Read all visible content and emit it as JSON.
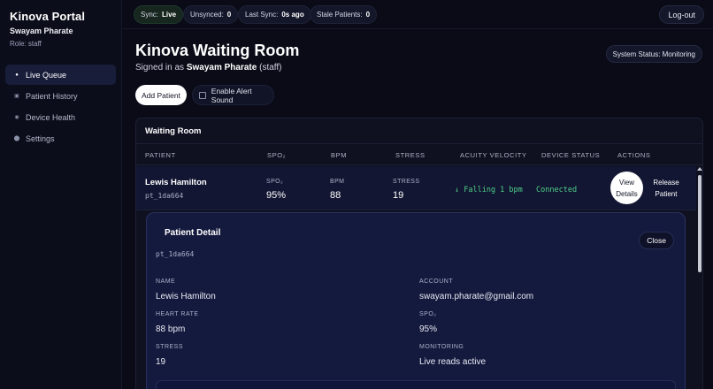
{
  "sidebar": {
    "brand": "Kinova Portal",
    "user_name": "Swayam Pharate",
    "user_role": "Role: staff",
    "items": [
      {
        "label": "Live Queue",
        "icon": "dot-icon"
      },
      {
        "label": "Patient History",
        "icon": "list-icon"
      },
      {
        "label": "Device Health",
        "icon": "gauge-icon"
      },
      {
        "label": "Settings",
        "icon": "gear-icon"
      }
    ]
  },
  "topbar": {
    "sync_label": "Sync:",
    "sync_value": "Live",
    "unsynced_label": "Unsynced:",
    "unsynced_value": "0",
    "last_sync_label": "Last Sync:",
    "last_sync_value": "0s ago",
    "stale_label": "Stale Patients:",
    "stale_value": "0",
    "logout_label": "Log-out"
  },
  "header": {
    "title": "Kinova Waiting Room",
    "signed_prefix": "Signed in as",
    "signed_name": "Swayam Pharate",
    "signed_role": "(staff)",
    "system_status": "System Status: Monitoring",
    "add_patient": "Add Patient",
    "alert_sound": "Enable Alert Sound"
  },
  "waiting_room": {
    "title": "Waiting Room",
    "columns": [
      "PATIENT",
      "SPO₂",
      "BPM",
      "STRESS",
      "ACUITY VELOCITY",
      "DEVICE STATUS",
      "ACTIONS"
    ],
    "row": {
      "name": "Lewis Hamilton",
      "id": "pt_1da664",
      "spo2_label": "SPO₂",
      "spo2_value": "95%",
      "bpm_label": "BPM",
      "bpm_value": "88",
      "stress_label": "STRESS",
      "stress_value": "19",
      "velocity": "↓ Falling 1 bpm",
      "device_status": "Connected",
      "view_line1": "View",
      "view_line2": "Details",
      "release_line1": "Release",
      "release_line2": "Patient"
    }
  },
  "detail": {
    "title": "Patient Detail",
    "id": "pt_1da664",
    "close": "Close",
    "fields": {
      "name_label": "NAME",
      "name_value": "Lewis Hamilton",
      "account_label": "ACCOUNT",
      "account_value": "swayam.pharate@gmail.com",
      "hr_label": "HEART RATE",
      "hr_value": "88 bpm",
      "spo2_label": "SPO₂",
      "spo2_value": "95%",
      "stress_label": "STRESS",
      "stress_value": "19",
      "monitoring_label": "MONITORING",
      "monitoring_value": "Live reads active"
    }
  }
}
